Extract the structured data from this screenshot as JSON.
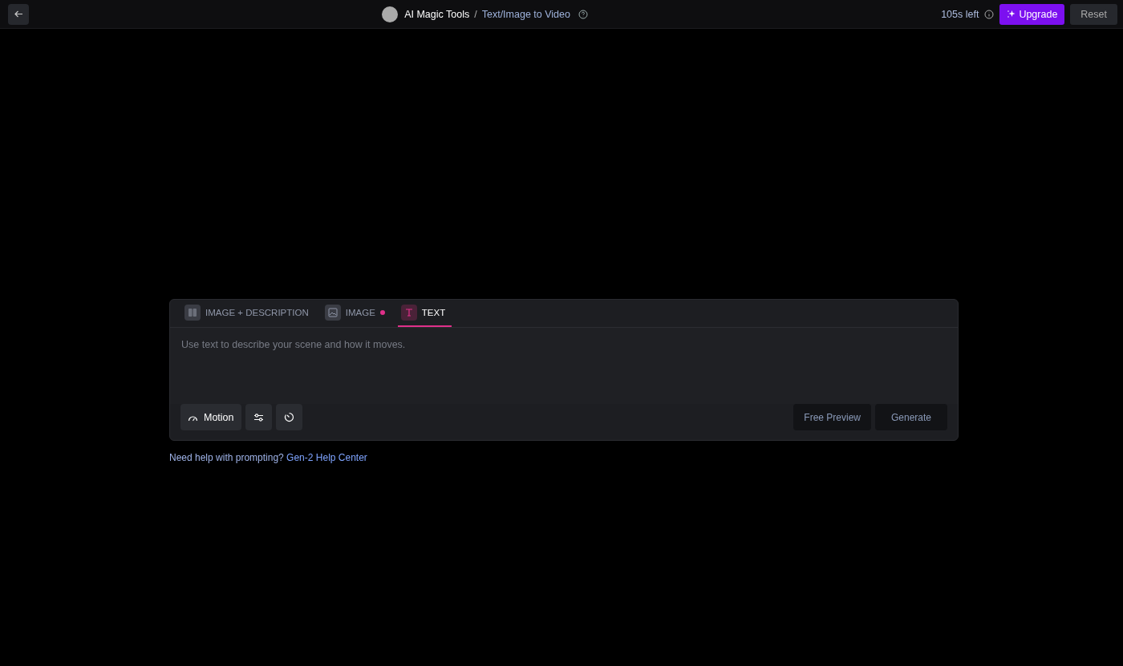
{
  "header": {
    "breadcrumb": [
      {
        "label": "AI Magic Tools",
        "kind": "root"
      },
      {
        "label": "/",
        "kind": "separator"
      },
      {
        "label": "Text/Image to Video",
        "kind": "current"
      }
    ],
    "credits": "105s left",
    "upgrade": "Upgrade",
    "reset": "Reset"
  },
  "tabs": [
    {
      "label": "IMAGE + DESCRIPTION",
      "kind": "split",
      "selected": false,
      "dot": false
    },
    {
      "label": "IMAGE",
      "kind": "image",
      "selected": false,
      "dot": true
    },
    {
      "label": "TEXT",
      "kind": "text",
      "selected": true,
      "dot": false
    }
  ],
  "prompt": {
    "placeholder": "Use text to describe your scene and how it moves."
  },
  "tools": [
    {
      "kind": "motion",
      "label": "Motion"
    },
    {
      "kind": "settings"
    },
    {
      "kind": "timer"
    }
  ],
  "actions": [
    "Free Preview",
    "Generate"
  ],
  "help": {
    "text": "Need help with prompting?",
    "link": "Gen-2 Help Center"
  }
}
